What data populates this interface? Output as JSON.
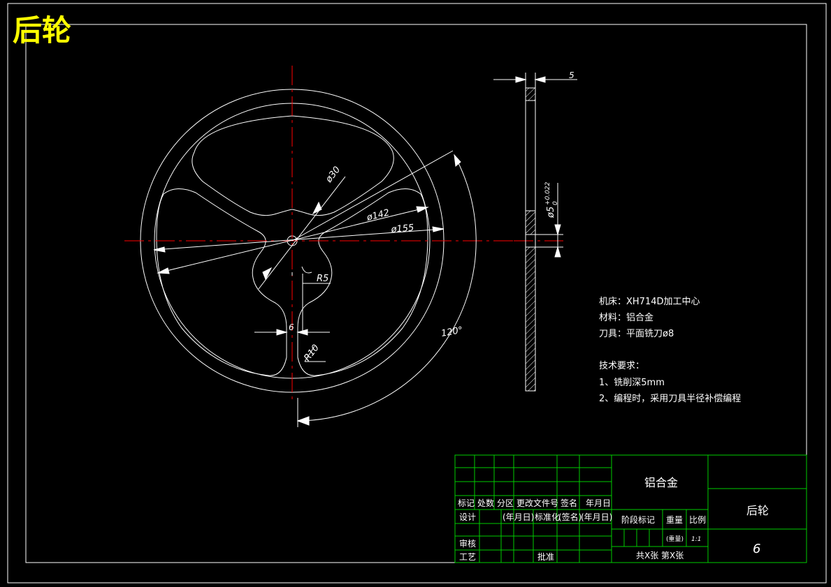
{
  "title": "后轮",
  "colors": {
    "background": "#000000",
    "outline": "#ffffff",
    "centerline": "#ff0000",
    "title_block_lines": "#00cc00",
    "title_text": "#ffff00"
  },
  "dimensions": {
    "d30": "ø30",
    "d142": "ø142",
    "d155": "ø155",
    "r5": "R5",
    "r10": "R10",
    "w6": "6",
    "angle": "120°",
    "thickness": "5",
    "hole": "ø5",
    "hole_tol_upper": "+0.022",
    "hole_tol_lower": "0"
  },
  "notes": {
    "machine": "机床：XH714D加工中心",
    "material": "材料：铝合金",
    "tool": "刀具：平面铣刀ø8",
    "tech_title": "技术要求：",
    "tech_1": "1、铣削深5mm",
    "tech_2": "2、编程时，采用刀具半径补偿编程"
  },
  "title_block": {
    "material": "铝合金",
    "part_name": "后轮",
    "drawing_no": "6",
    "row_headers": [
      "标记",
      "处数",
      "分区",
      "更改文件号",
      "签名",
      "年月日"
    ],
    "design": "设计",
    "date_paren": "(年月日)",
    "standardize": "标准化",
    "sign_paren": "(签名)",
    "stage_mark": "阶段标记",
    "weight": "重量",
    "scale": "比例",
    "weight_value": "(重量)",
    "scale_value": "1:1",
    "review": "审核",
    "process": "工艺",
    "approve": "批准",
    "sheets": "共X张 第X张"
  }
}
